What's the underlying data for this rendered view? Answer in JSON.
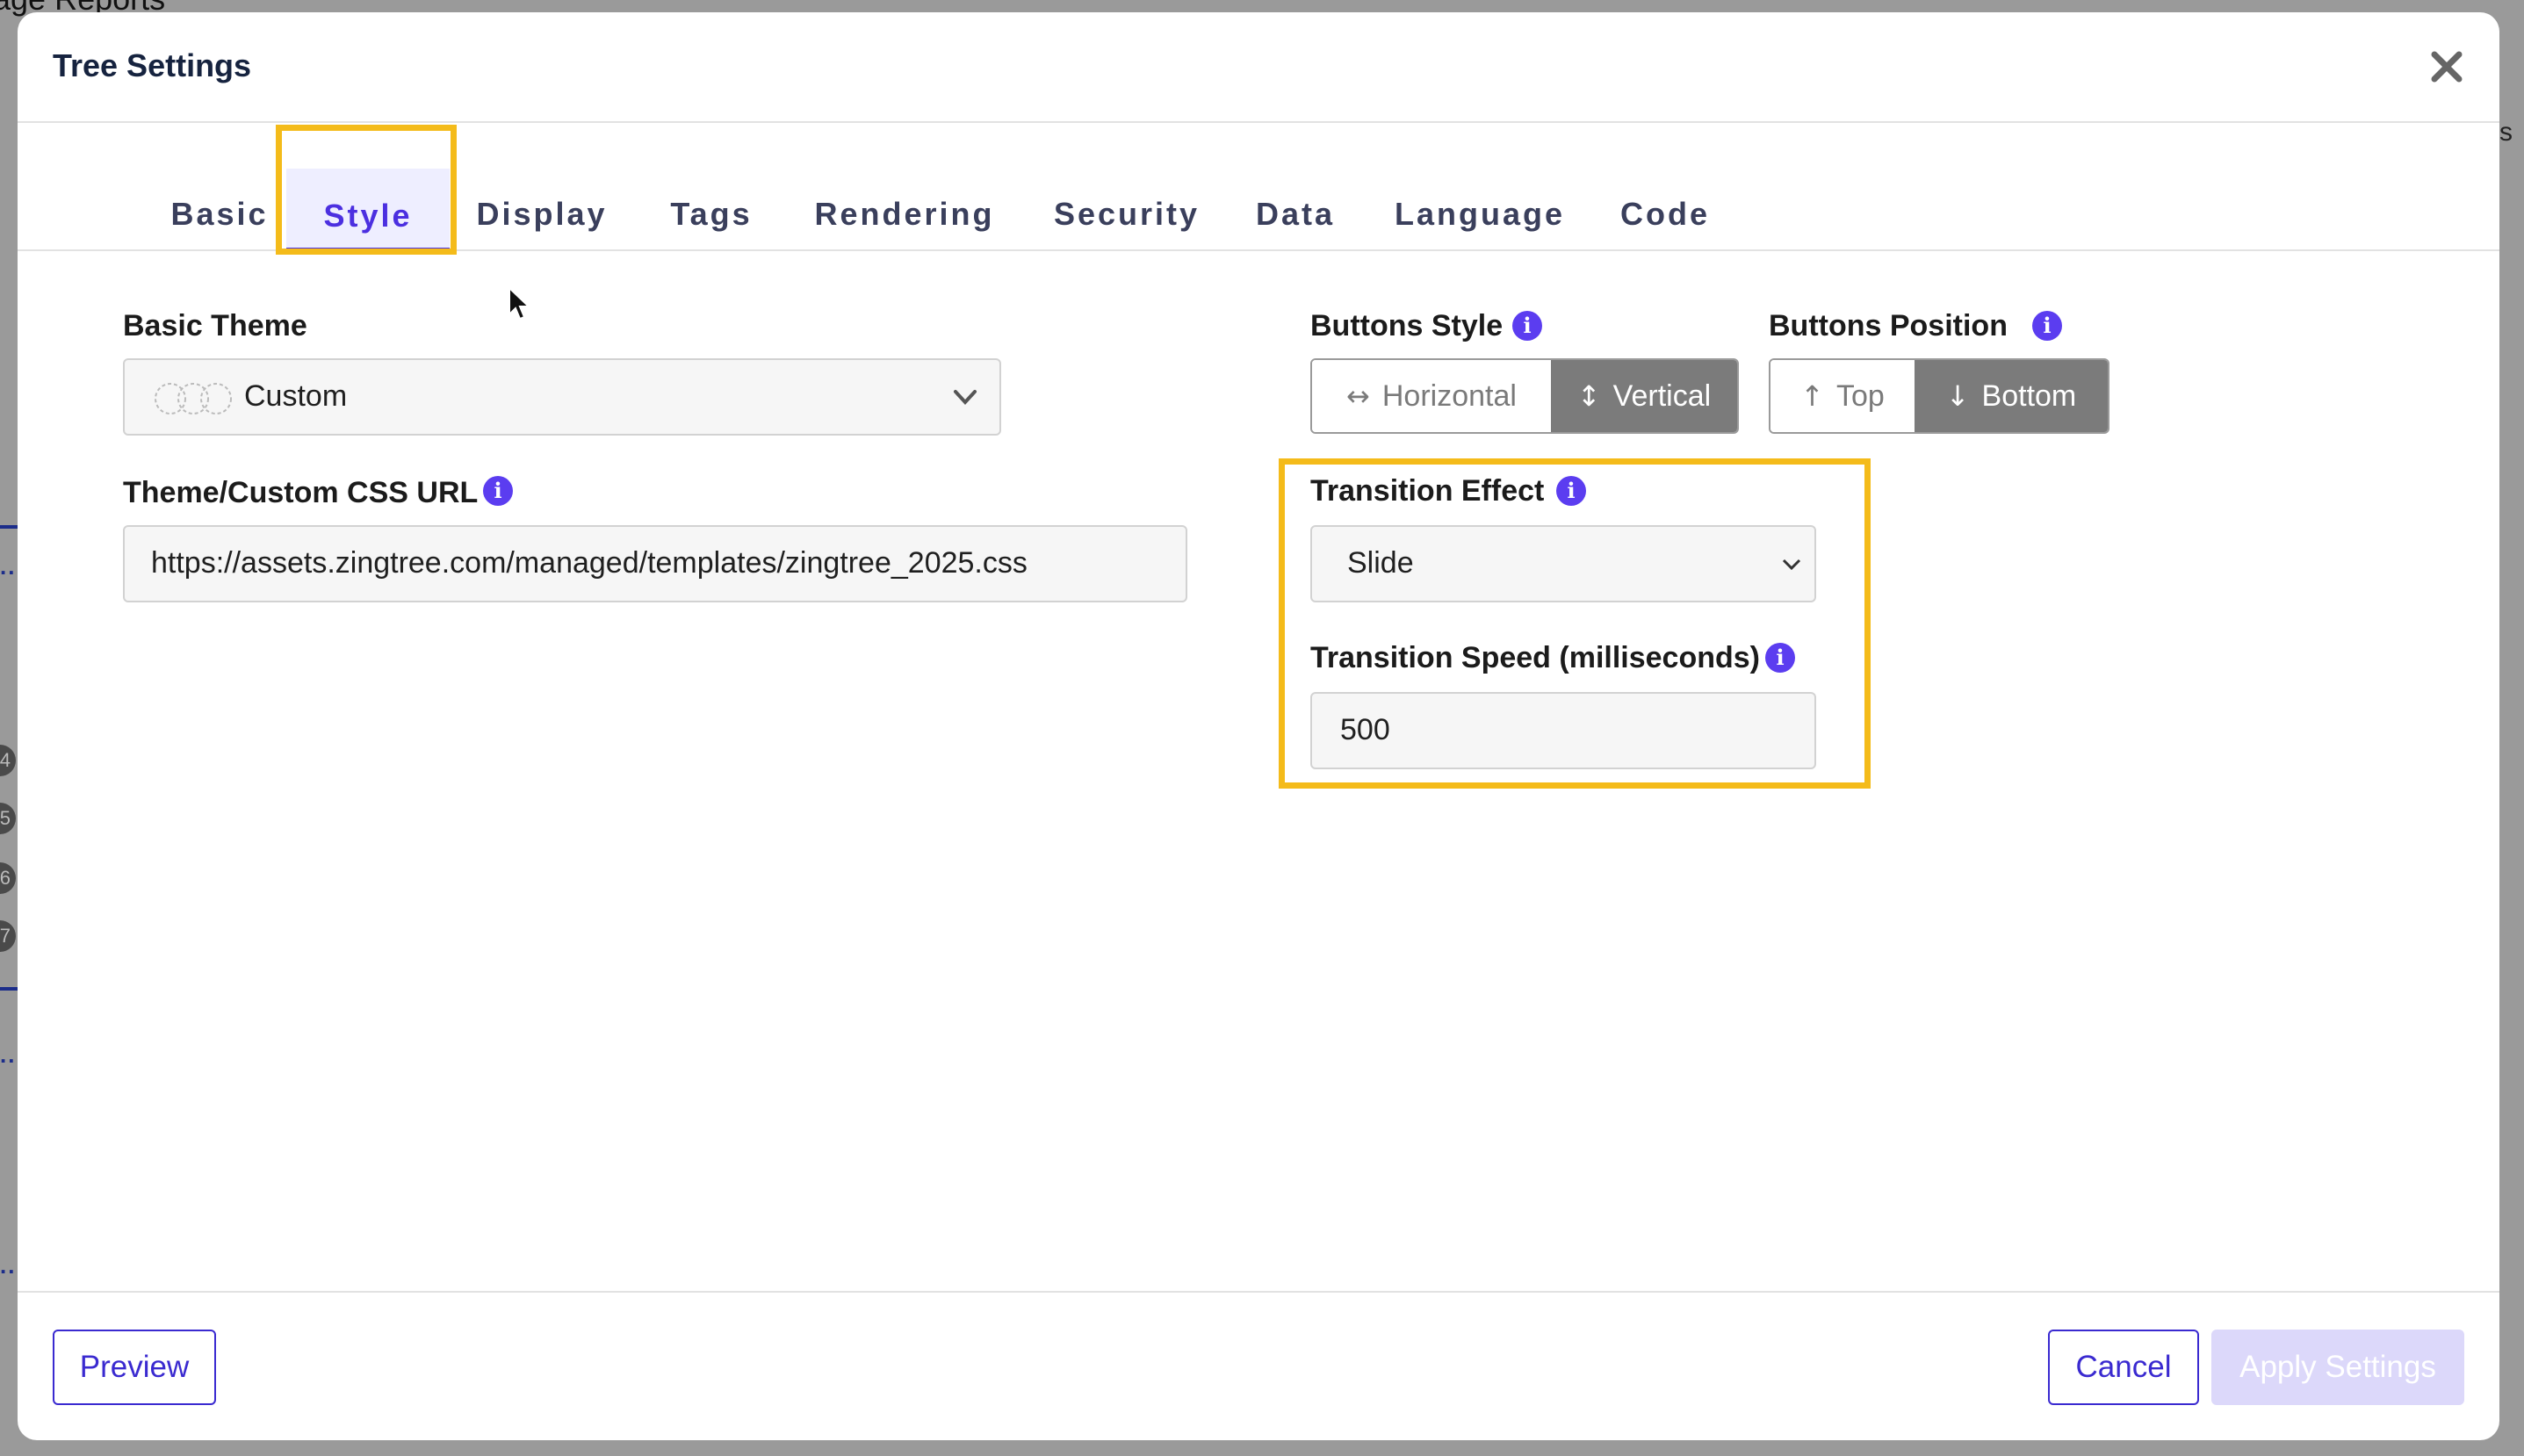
{
  "background": {
    "page_title_fragment": "age Reports",
    "right_edge_letter": "s",
    "side_badges": [
      "4",
      "5",
      "6",
      "7"
    ],
    "dots": "..."
  },
  "modal": {
    "title": "Tree Settings",
    "close_icon": "close-icon"
  },
  "tabs": [
    {
      "label": "Basic"
    },
    {
      "label": "Style"
    },
    {
      "label": "Display"
    },
    {
      "label": "Tags"
    },
    {
      "label": "Rendering"
    },
    {
      "label": "Security"
    },
    {
      "label": "Data"
    },
    {
      "label": "Language"
    },
    {
      "label": "Code"
    }
  ],
  "active_tab": "Style",
  "style": {
    "basic_theme": {
      "label": "Basic Theme",
      "value": "Custom",
      "icon": "theme-swatch-icon"
    },
    "css_url": {
      "label": "Theme/Custom CSS URL",
      "value": "https://assets.zingtree.com/managed/templates/zingtree_2025.css"
    },
    "buttons_style": {
      "label": "Buttons Style",
      "options": [
        "Horizontal",
        "Vertical"
      ],
      "selected": "Vertical"
    },
    "buttons_position": {
      "label": "Buttons Position",
      "options": [
        "Top",
        "Bottom"
      ],
      "selected": "Bottom"
    },
    "transition_effect": {
      "label": "Transition Effect",
      "value": "Slide"
    },
    "transition_speed": {
      "label": "Transition Speed (milliseconds)",
      "value": "500"
    },
    "info_glyph": "i"
  },
  "footer": {
    "preview_label": "Preview",
    "cancel_label": "Cancel",
    "apply_label": "Apply Settings"
  },
  "colors": {
    "accent": "#4b2fe0",
    "highlight": "#f4bb1a",
    "apply_disabled": "#dcd8fa"
  }
}
